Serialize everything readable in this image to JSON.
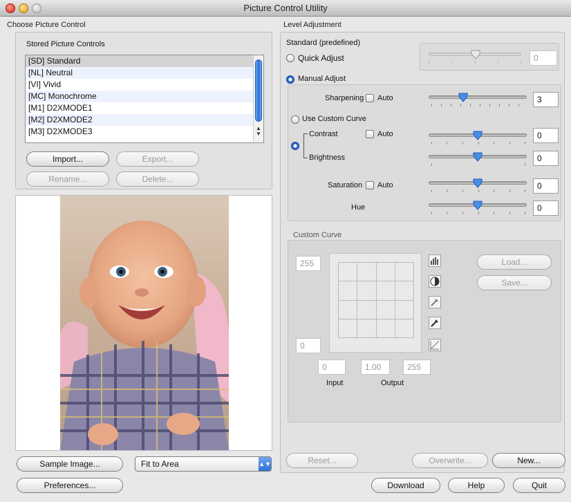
{
  "window": {
    "title": "Picture Control Utility"
  },
  "choose": {
    "title": "Choose Picture Control",
    "stored_title": "Stored Picture Controls",
    "items": [
      "[SD] Standard",
      "[NL] Neutral",
      "[VI] Vivid",
      "[MC] Monochrome",
      "[M1] D2XMODE1",
      "[M2] D2XMODE2",
      "[M3] D2XMODE3"
    ],
    "selected": "[SD] Standard",
    "import_label": "Import...",
    "export_label": "Export...",
    "rename_label": "Rename...",
    "delete_label": "Delete..."
  },
  "preview": {
    "sample_image_label": "Sample Image...",
    "zoom_value": "Fit to Area",
    "preferences_label": "Preferences..."
  },
  "level": {
    "title": "Level Adjustment",
    "preset_name": "Standard (predefined)",
    "quick_adjust_label": "Quick Adjust",
    "quick_adjust_value": "0",
    "manual_adjust_label": "Manual Adjust",
    "mode": "Manual Adjust",
    "sharpening_label": "Sharpening",
    "sharpening_value": "3",
    "auto_label": "Auto",
    "use_custom_curve_label": "Use Custom Curve",
    "contrast_label": "Contrast",
    "contrast_value": "0",
    "brightness_label": "Brightness",
    "brightness_value": "0",
    "saturation_label": "Saturation",
    "saturation_value": "0",
    "hue_label": "Hue",
    "hue_value": "0"
  },
  "curve": {
    "title": "Custom Curve",
    "max_value": "255",
    "min_value": "0",
    "input_low": "0",
    "gamma": "1.00",
    "input_high": "255",
    "input_label": "Input",
    "output_label": "Output",
    "load_label": "Load...",
    "save_label": "Save..."
  },
  "actions": {
    "reset_label": "Reset...",
    "overwrite_label": "Overwrite...",
    "new_label": "New...",
    "download_label": "Download",
    "help_label": "Help",
    "quit_label": "Quit"
  }
}
